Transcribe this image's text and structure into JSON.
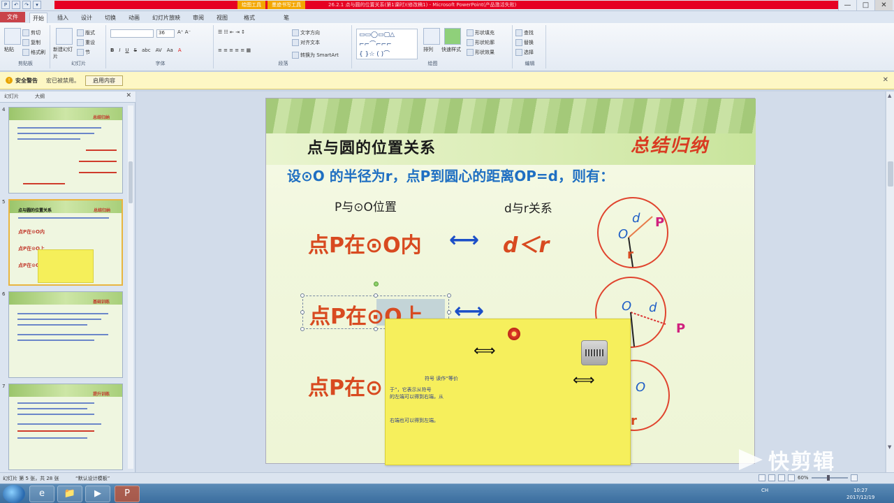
{
  "window": {
    "title": "26.2.1 点与圆的位置关系(第1课时)(修改稿1) - Microsoft PowerPoint(产品激活失败)",
    "context_tabs": [
      "绘图工具",
      "墨迹书写工具"
    ],
    "controls": {
      "minimize": "—",
      "maximize": "□",
      "close": "✕"
    }
  },
  "quick_access": [
    "P",
    "↶",
    "↷",
    "▾"
  ],
  "ribbon": {
    "tabs": [
      "文件",
      "开始",
      "插入",
      "设计",
      "切换",
      "动画",
      "幻灯片放映",
      "审阅",
      "视图",
      "格式",
      "笔"
    ],
    "active_tab": "开始",
    "groups": {
      "clipboard": {
        "label": "剪贴板",
        "paste": "粘贴",
        "cut": "剪切",
        "copy": "复制",
        "format_painter": "格式刷"
      },
      "slides": {
        "label": "幻灯片",
        "new_slide": "新建幻灯片",
        "layout": "版式",
        "reset": "重设",
        "section": "节"
      },
      "font": {
        "label": "字体",
        "size": "36",
        "buttons": [
          "B",
          "I",
          "U",
          "S",
          "abc",
          "AV",
          "Aa",
          "A"
        ]
      },
      "paragraph": {
        "label": "段落",
        "text_direction": "文字方向",
        "align_text": "对齐文本",
        "smartart": "转换为 SmartArt"
      },
      "drawing": {
        "label": "绘图",
        "arrange": "排列",
        "quick_styles": "快速样式",
        "shape_fill": "形状填充",
        "shape_outline": "形状轮廓",
        "shape_effects": "形状效果"
      },
      "editing": {
        "label": "编辑",
        "find": "查找",
        "replace": "替换",
        "select": "选择"
      }
    }
  },
  "security_bar": {
    "title": "安全警告",
    "message": "宏已被禁用。",
    "button": "启用内容"
  },
  "left_pane": {
    "tabs": [
      "幻灯片",
      "大纲"
    ],
    "slides": [
      {
        "num": "4",
        "title": "总结归纳"
      },
      {
        "num": "5",
        "title": "总结归纳",
        "heading": "点与圆的位置关系",
        "rows": [
          "点P在⊙O内",
          "点P在⊙O上",
          "点P在⊙O外"
        ]
      },
      {
        "num": "6",
        "title": "基础训练"
      },
      {
        "num": "7",
        "title": "提升训练"
      }
    ]
  },
  "slide": {
    "title": "点与圆的位置关系",
    "summary_label": "总结归纳",
    "intro": "设⊙O 的半径为r，点P到圆心的距离OP=d，则有：",
    "col_position": "P与⊙O位置",
    "col_relation": "d与r关系",
    "row1_position": "点P在⊙O内",
    "row1_relation": "d＜r",
    "row2_position": "点P在⊙O上",
    "row3_position": "点P在⊙",
    "arrow_symbol": "⟷",
    "circle_labels": {
      "O": "O",
      "d": "d",
      "P": "P",
      "r": "r"
    }
  },
  "sticky_note": {
    "double_arrow": "⟺",
    "line1": "符号 读作“等价",
    "line2": "于”，它表示从符号",
    "line3": "的左端可以得到右端，从",
    "line4": "右端也可以得到左端。"
  },
  "status_bar": {
    "slide_info": "幻灯片 第 5 张，共 28 张",
    "theme": "“默认设计模板”",
    "zoom": "60%"
  },
  "taskbar": {
    "apps": [
      "e",
      "📁",
      "▶",
      "P"
    ],
    "tray": "CH",
    "time": "10:27",
    "date": "2017/12/19"
  },
  "watermark": {
    "text": "快剪辑"
  },
  "colors": {
    "accent_red": "#d84a20",
    "accent_blue": "#1f6fc2",
    "ribbon_bg": "#e4ebf4",
    "sticky_yellow": "#f6ef5c"
  }
}
